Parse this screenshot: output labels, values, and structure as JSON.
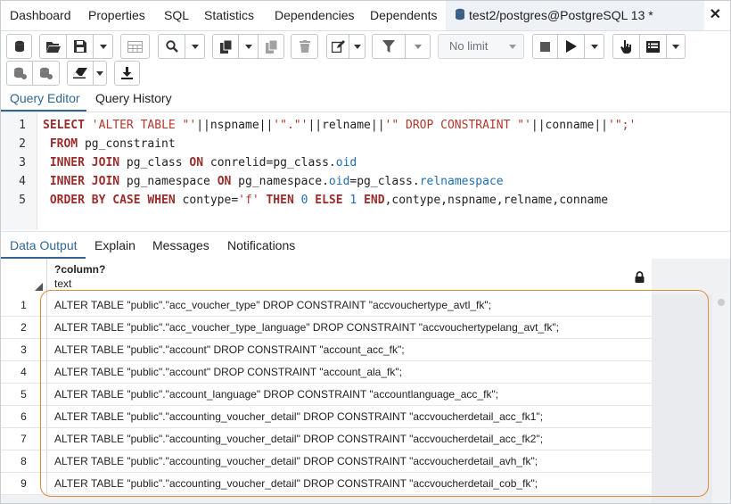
{
  "tabs": {
    "items": [
      "Dashboard",
      "Properties",
      "SQL",
      "Statistics",
      "Dependencies",
      "Dependents"
    ],
    "active_label": "test2/postgres@PostgreSQL 13 *",
    "close": "✕"
  },
  "toolbar": {
    "limit_value": "No limit"
  },
  "editor_tabs": [
    "Query Editor",
    "Query History"
  ],
  "editor": {
    "line_numbers": [
      "1",
      "2",
      "3",
      "4",
      "5"
    ]
  },
  "output_tabs": [
    "Data Output",
    "Explain",
    "Messages",
    "Notifications"
  ],
  "grid": {
    "column_name": "?column?",
    "column_type": "text",
    "rows": [
      {
        "n": "1",
        "value": "ALTER TABLE \"public\".\"acc_voucher_type\" DROP CONSTRAINT \"accvouchertype_avtl_fk\";"
      },
      {
        "n": "2",
        "value": "ALTER TABLE \"public\".\"acc_voucher_type_language\" DROP CONSTRAINT \"accvouchertypelang_avt_fk\";"
      },
      {
        "n": "3",
        "value": "ALTER TABLE \"public\".\"account\" DROP CONSTRAINT \"account_acc_fk\";"
      },
      {
        "n": "4",
        "value": "ALTER TABLE \"public\".\"account\" DROP CONSTRAINT \"account_ala_fk\";"
      },
      {
        "n": "5",
        "value": "ALTER TABLE \"public\".\"account_language\" DROP CONSTRAINT \"accountlanguage_acc_fk\";"
      },
      {
        "n": "6",
        "value": "ALTER TABLE \"public\".\"accounting_voucher_detail\" DROP CONSTRAINT \"accvoucherdetail_acc_fk1\";"
      },
      {
        "n": "7",
        "value": "ALTER TABLE \"public\".\"accounting_voucher_detail\" DROP CONSTRAINT \"accvoucherdetail_acc_fk2\";"
      },
      {
        "n": "8",
        "value": "ALTER TABLE \"public\".\"accounting_voucher_detail\" DROP CONSTRAINT \"accvoucherdetail_avh_fk\";"
      },
      {
        "n": "9",
        "value": "ALTER TABLE \"public\".\"accounting_voucher_detail\" DROP CONSTRAINT \"accvoucherdetail_cob_fk\";"
      }
    ]
  },
  "colors": {
    "accent": "#326690",
    "highlight": "#e08a3a"
  }
}
